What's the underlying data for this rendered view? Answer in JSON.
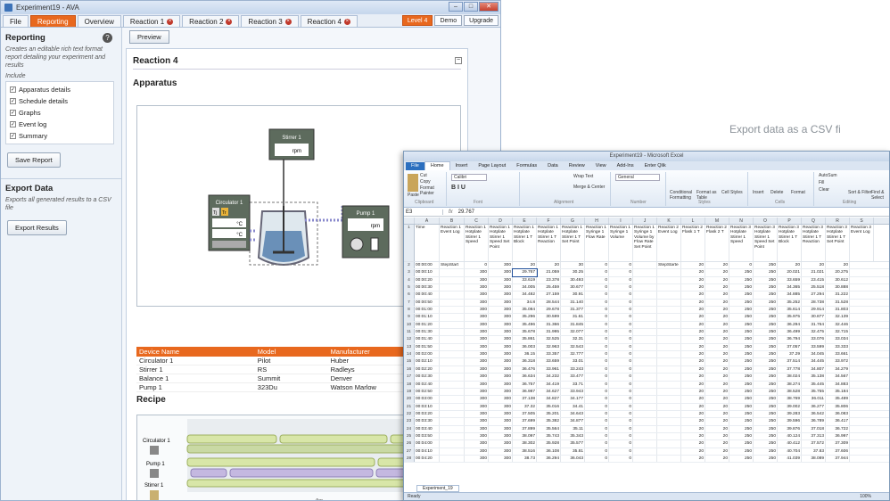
{
  "app": {
    "title": "Experiment19 - AVA"
  },
  "tabs": [
    "File",
    "Reporting",
    "Overview",
    "Reaction 1",
    "Reaction 2",
    "Reaction 3",
    "Reaction 4"
  ],
  "toolbar": {
    "level": "Level 4",
    "demo": "Demo",
    "upgrade": "Upgrade"
  },
  "sidebar": {
    "reporting_title": "Reporting",
    "reporting_desc": "Creates an editable rich text format report detailing your experiment and results",
    "include_label": "Include",
    "options": [
      "Apparatus details",
      "Schedule details",
      "Graphs",
      "Event log",
      "Summary"
    ],
    "save_button": "Save Report",
    "export_title": "Export Data",
    "export_desc": "Exports all generated results to a CSV file",
    "export_button": "Export Results"
  },
  "report": {
    "preview_button": "Preview",
    "title": "Reaction 4",
    "apparatus_heading": "Apparatus",
    "recipe_heading": "Recipe",
    "diagram": {
      "stirrer_label": "Stirrer 1",
      "stirrer_unit": "rpm",
      "circulator_label": "Circulator 1",
      "circ_tj": "Tj",
      "circ_tr": "Tr",
      "circ_unit1": "°C",
      "circ_unit2": "°C",
      "pump_label": "Pump 1",
      "pump_unit": "rpm"
    },
    "device_table": {
      "headers": [
        "Device Name",
        "Model",
        "Manufacturer"
      ],
      "rows": [
        [
          "Circulator 1",
          "Pilot",
          "Huber"
        ],
        [
          "Stirrer 1",
          "RS",
          "Radleys"
        ],
        [
          "Balance 1",
          "Summit",
          "Denver"
        ],
        [
          "Pump 1",
          "323Du",
          "Watson Marlow"
        ]
      ]
    },
    "recipe": {
      "lanes": [
        "Circulator 1",
        "Pump 1",
        "Stirrer 1"
      ],
      "ticks": [
        "2m",
        "4m"
      ]
    }
  },
  "caption": "Export data as a CSV fi",
  "excel": {
    "title": "Experiment19 - Microsoft Excel",
    "ribbon_tabs": [
      "File",
      "Home",
      "Insert",
      "Page Layout",
      "Formulas",
      "Data",
      "Review",
      "View",
      "Add-Ins",
      "Enter Qlik"
    ],
    "ribbon_labels": {
      "paste": "Paste",
      "cut": "Cut",
      "copy": "Copy",
      "format_painter": "Format Painter",
      "font": "Calibri",
      "wrap": "Wrap Text",
      "merge": "Merge & Center",
      "general": "General",
      "cond": "Conditional Formatting",
      "format_table": "Format as Table",
      "cell_styles": "Cell Styles",
      "insert": "Insert",
      "delete": "Delete",
      "format": "Format",
      "autosum": "AutoSum",
      "fill": "Fill",
      "clear": "Clear",
      "sort": "Sort & Filter",
      "find": "Find & Select",
      "clipboard": "Clipboard",
      "font_group": "Font",
      "alignment": "Alignment",
      "number": "Number",
      "styles": "Styles",
      "cells": "Cells",
      "editing": "Editing"
    },
    "name_box": "E3",
    "formula": "29.767",
    "columns": [
      "A",
      "B",
      "C",
      "D",
      "E",
      "F",
      "G",
      "H",
      "I",
      "J",
      "K",
      "L",
      "M",
      "N",
      "O",
      "P",
      "Q",
      "R",
      "S"
    ],
    "headers": [
      "Time",
      "Reaction 1 Event Log",
      "Reaction 1 Hotplate Stirrer 1 Speed",
      "Reaction 1 Hotplate Stirrer 1 Speed Set Point",
      "Reaction 1 Hotplate Stirrer 1 T Block",
      "Reaction 1 Hotplate Stirrer 1 T Reaction",
      "Reaction 1 Hotplate Stirrer 1 T Set Point",
      "Reaction 1 Syringe 1 Flow Rate",
      "Reaction 1 Syringe 1 Volume",
      "Reaction 1 Syringe 1 Volume by Flow Rate Set Point",
      "Reaction 2 Event Log",
      "Reaction 2 Flask 1 T",
      "Reaction 2 Flask 2 T",
      "Reaction 3 Hotplate Stirrer 1 Speed",
      "Reaction 3 Hotplate Stirrer 1 Speed Set Point",
      "Reaction 3 Hotplate Stirrer 1 T Block",
      "Reaction 3 Hotplate Stirrer 1 T Reaction",
      "Reaction 3 Hotplate Stirrer 1 T Set Point",
      "Reaction 3 Event Log"
    ],
    "rows": [
      [
        "00:00:00",
        "StepStart",
        "0",
        "300",
        "20",
        "20",
        "30",
        "0",
        "0",
        "",
        "StepStarte",
        "20",
        "20",
        "0",
        "250",
        "20",
        "20",
        "20"
      ],
      [
        "00:00:10",
        "",
        "300",
        "300",
        "29.767",
        "21.059",
        "30.25",
        "0",
        "0",
        "",
        "",
        "20",
        "20",
        "250",
        "250",
        "20.021",
        "21.021",
        "20.275"
      ],
      [
        "00:00:20",
        "",
        "300",
        "300",
        "33.619",
        "23.378",
        "30.493",
        "0",
        "0",
        "",
        "",
        "20",
        "20",
        "250",
        "250",
        "33.659",
        "23.415",
        "30.612"
      ],
      [
        "00:00:30",
        "",
        "300",
        "300",
        "34.005",
        "25.459",
        "30.677",
        "0",
        "0",
        "",
        "",
        "20",
        "20",
        "250",
        "250",
        "34.365",
        "25.518",
        "30.888"
      ],
      [
        "00:00:40",
        "",
        "300",
        "300",
        "34.482",
        "27.159",
        "30.91",
        "0",
        "0",
        "",
        "",
        "20",
        "20",
        "250",
        "250",
        "34.885",
        "27.294",
        "31.222"
      ],
      [
        "00:00:50",
        "",
        "300",
        "300",
        "34.8",
        "28.544",
        "31.140",
        "0",
        "0",
        "",
        "",
        "20",
        "20",
        "250",
        "250",
        "35.252",
        "28.738",
        "31.528"
      ],
      [
        "00:01:00",
        "",
        "300",
        "300",
        "35.084",
        "29.678",
        "31.377",
        "0",
        "0",
        "",
        "",
        "20",
        "20",
        "250",
        "250",
        "35.614",
        "29.914",
        "31.803"
      ],
      [
        "00:01:10",
        "",
        "300",
        "300",
        "35.296",
        "30.599",
        "31.61",
        "0",
        "0",
        "",
        "",
        "20",
        "20",
        "250",
        "250",
        "35.975",
        "30.877",
        "32.139"
      ],
      [
        "00:01:20",
        "",
        "300",
        "300",
        "35.496",
        "31.366",
        "31.845",
        "0",
        "0",
        "",
        "",
        "20",
        "20",
        "250",
        "250",
        "36.294",
        "31.764",
        "32.446"
      ],
      [
        "00:01:30",
        "",
        "300",
        "300",
        "35.678",
        "31.995",
        "32.077",
        "0",
        "0",
        "",
        "",
        "20",
        "20",
        "250",
        "250",
        "36.499",
        "32.475",
        "32.715"
      ],
      [
        "00:01:40",
        "",
        "300",
        "300",
        "35.861",
        "32.525",
        "32.31",
        "0",
        "0",
        "",
        "",
        "20",
        "20",
        "250",
        "250",
        "36.794",
        "33.076",
        "33.034"
      ],
      [
        "00:01:50",
        "",
        "300",
        "300",
        "36.003",
        "32.963",
        "32.543",
        "0",
        "0",
        "",
        "",
        "20",
        "20",
        "250",
        "250",
        "37.057",
        "33.599",
        "33.333"
      ],
      [
        "00:02:00",
        "",
        "300",
        "300",
        "36.15",
        "33.357",
        "32.777",
        "0",
        "0",
        "",
        "",
        "20",
        "20",
        "250",
        "250",
        "37.29",
        "34.045",
        "33.661"
      ],
      [
        "00:02:10",
        "",
        "300",
        "300",
        "36.318",
        "33.659",
        "33.01",
        "0",
        "0",
        "",
        "",
        "20",
        "20",
        "250",
        "250",
        "37.514",
        "34.445",
        "33.972"
      ],
      [
        "00:02:20",
        "",
        "300",
        "300",
        "36.476",
        "33.961",
        "33.243",
        "0",
        "0",
        "",
        "",
        "20",
        "20",
        "250",
        "250",
        "37.778",
        "34.807",
        "34.279"
      ],
      [
        "00:02:30",
        "",
        "300",
        "300",
        "36.634",
        "34.232",
        "33.477",
        "0",
        "0",
        "",
        "",
        "20",
        "20",
        "250",
        "250",
        "38.024",
        "35.138",
        "34.567"
      ],
      [
        "00:02:40",
        "",
        "300",
        "300",
        "36.757",
        "34.419",
        "33.71",
        "0",
        "0",
        "",
        "",
        "20",
        "20",
        "250",
        "250",
        "38.274",
        "35.445",
        "34.883"
      ],
      [
        "00:02:50",
        "",
        "300",
        "300",
        "36.987",
        "34.627",
        "33.943",
        "0",
        "0",
        "",
        "",
        "20",
        "20",
        "250",
        "250",
        "38.528",
        "35.755",
        "35.184"
      ],
      [
        "00:03:00",
        "",
        "300",
        "300",
        "37.138",
        "34.827",
        "34.177",
        "0",
        "0",
        "",
        "",
        "20",
        "20",
        "250",
        "250",
        "38.769",
        "36.011",
        "35.489"
      ],
      [
        "00:03:10",
        "",
        "300",
        "300",
        "37.32",
        "35.016",
        "34.41",
        "0",
        "0",
        "",
        "",
        "20",
        "20",
        "250",
        "250",
        "39.002",
        "36.277",
        "35.806"
      ],
      [
        "00:03:20",
        "",
        "300",
        "300",
        "37.505",
        "35.201",
        "34.643",
        "0",
        "0",
        "",
        "",
        "20",
        "20",
        "250",
        "250",
        "39.283",
        "36.542",
        "36.083"
      ],
      [
        "00:03:30",
        "",
        "300",
        "300",
        "37.699",
        "35.382",
        "34.877",
        "0",
        "0",
        "",
        "",
        "20",
        "20",
        "250",
        "250",
        "39.596",
        "36.789",
        "36.417"
      ],
      [
        "00:03:40",
        "",
        "300",
        "300",
        "37.899",
        "35.564",
        "35.11",
        "0",
        "0",
        "",
        "",
        "20",
        "20",
        "250",
        "250",
        "39.876",
        "37.018",
        "36.722"
      ],
      [
        "00:03:50",
        "",
        "300",
        "300",
        "38.097",
        "35.743",
        "35.343",
        "0",
        "0",
        "",
        "",
        "20",
        "20",
        "250",
        "250",
        "40.124",
        "37.313",
        "36.997"
      ],
      [
        "00:04:00",
        "",
        "300",
        "300",
        "38.302",
        "35.928",
        "35.577",
        "0",
        "0",
        "",
        "",
        "20",
        "20",
        "250",
        "250",
        "40.412",
        "37.572",
        "37.309"
      ],
      [
        "00:04:10",
        "",
        "300",
        "300",
        "38.516",
        "36.108",
        "35.81",
        "0",
        "0",
        "",
        "",
        "20",
        "20",
        "250",
        "250",
        "40.704",
        "37.83",
        "37.606"
      ],
      [
        "00:04:20",
        "",
        "300",
        "300",
        "38.73",
        "36.294",
        "36.043",
        "0",
        "0",
        "",
        "",
        "20",
        "20",
        "250",
        "250",
        "41.039",
        "38.089",
        "37.944"
      ]
    ],
    "sheet_tab": "Experiment_19",
    "status": "Ready",
    "zoom": "100%"
  }
}
